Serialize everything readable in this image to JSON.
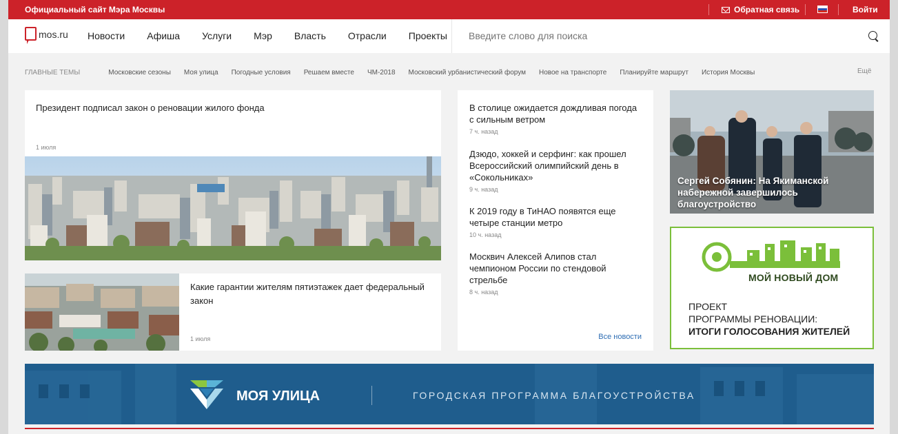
{
  "topbar": {
    "site": "Официальный сайт Мэра Москвы",
    "feedback": "Обратная связь",
    "login": "Войти",
    "mail_icon": "mail-icon",
    "flag_icon": "russia-flag-icon"
  },
  "header": {
    "logo_text": "mos.ru",
    "nav": [
      "Новости",
      "Афиша",
      "Услуги",
      "Мэр",
      "Власть",
      "Отрасли",
      "Проекты"
    ],
    "search_placeholder": "Введите слово для поиска"
  },
  "topics": {
    "label": "Главные темы",
    "items": [
      "Московские сезоны",
      "Моя улица",
      "Погодные условия",
      "Решаем вместе",
      "ЧМ-2018",
      "Московский урбанистический форум",
      "Новое на транспорте",
      "Планируйте маршрут",
      "История Москвы"
    ],
    "more": "Ещё"
  },
  "main_news": {
    "title": "Президент подписал закон о реновации жилого фонда",
    "date": "1 июля"
  },
  "second_news": {
    "title": "Какие гарантии жителям пятиэтажек дает федеральный закон",
    "date": "1 июля"
  },
  "feed": {
    "items": [
      {
        "title": "В столице ожидается дождливая погода с сильным ветром",
        "time": "7 ч. назад"
      },
      {
        "title": "Дзюдо, хоккей и серфинг: как прошел Всероссийский олимпийский день в «Сокольниках»",
        "time": "9 ч. назад"
      },
      {
        "title": "К 2019 году в ТиНАО появятся еще четыре станции метро",
        "time": "10 ч. назад"
      },
      {
        "title": "Москвич Алексей Алипов стал чемпионом России по стендовой стрельбе",
        "time": "8 ч. назад"
      }
    ],
    "all_news": "Все новости"
  },
  "photo_card": {
    "caption": "Сергей Собянин: На Якиманской набережной завершилось благоустройство"
  },
  "promo": {
    "brand": "МОЙ НОВЫЙ ДОМ",
    "line1": "ПРОЕКТ",
    "line2": "ПРОГРАММЫ РЕНОВАЦИИ:",
    "line3": "ИТОГИ ГОЛОСОВАНИЯ ЖИТЕЛЕЙ"
  },
  "banner": {
    "title": "МОЯ УЛИЦА",
    "subtitle": "ГОРОДСКАЯ ПРОГРАММА БЛАГОУСТРОЙСТВА"
  },
  "colors": {
    "brand_red": "#cc2229",
    "link_blue": "#2d6db3",
    "promo_green": "#7bbf3a",
    "banner_blue": "#1d5b8b"
  }
}
